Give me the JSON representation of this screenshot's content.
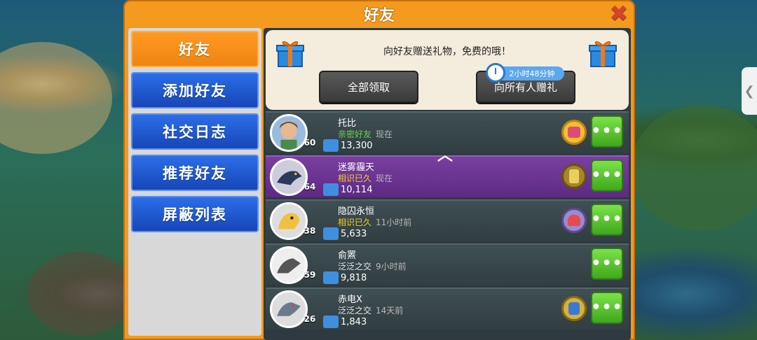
{
  "panel": {
    "title": "好友"
  },
  "sidebar": {
    "items": [
      {
        "label": "好友",
        "active": true
      },
      {
        "label": "添加好友",
        "active": false
      },
      {
        "label": "社交日志",
        "active": false
      },
      {
        "label": "推荐好友",
        "active": false
      },
      {
        "label": "屏蔽列表",
        "active": false
      }
    ]
  },
  "gift": {
    "message": "向好友赠送礼物，免费的哦！",
    "claim_all_label": "全部领取",
    "gift_all_label": "向所有人赠礼",
    "timer": "2小时48分钟"
  },
  "friends": [
    {
      "name": "托比",
      "relation": "亲密好友",
      "relation_color": "green",
      "last_seen": "现在",
      "level": "60",
      "score": "13,300",
      "badge": "pink-crown-badge"
    },
    {
      "name": "迷雾霾天",
      "relation": "相识已久",
      "relation_color": "yellow",
      "last_seen": "现在",
      "level": "64",
      "score": "10,114",
      "badge": "gold-trophy-badge"
    },
    {
      "name": "隐囚永恒",
      "relation": "相识已久",
      "relation_color": "yellow",
      "last_seen": "11小时前",
      "level": "38",
      "score": "5,633",
      "badge": "purple-helmet-badge"
    },
    {
      "name": "俞罴",
      "relation": "泛泛之交",
      "relation_color": "white",
      "last_seen": "9小时前",
      "level": "59",
      "score": "9,818",
      "badge": ""
    },
    {
      "name": "赤电X",
      "relation": "泛泛之交",
      "relation_color": "white",
      "last_seen": "14天前",
      "level": "26",
      "score": "1,843",
      "badge": "blue-robot-badge"
    }
  ],
  "more_label": "•••",
  "colors": {
    "panel": "#f39a1f",
    "active_tab": "#f08410",
    "tab_blue": "#1646b8",
    "more_green": "#3fa81c",
    "highlight_row": "#5c2a82"
  }
}
